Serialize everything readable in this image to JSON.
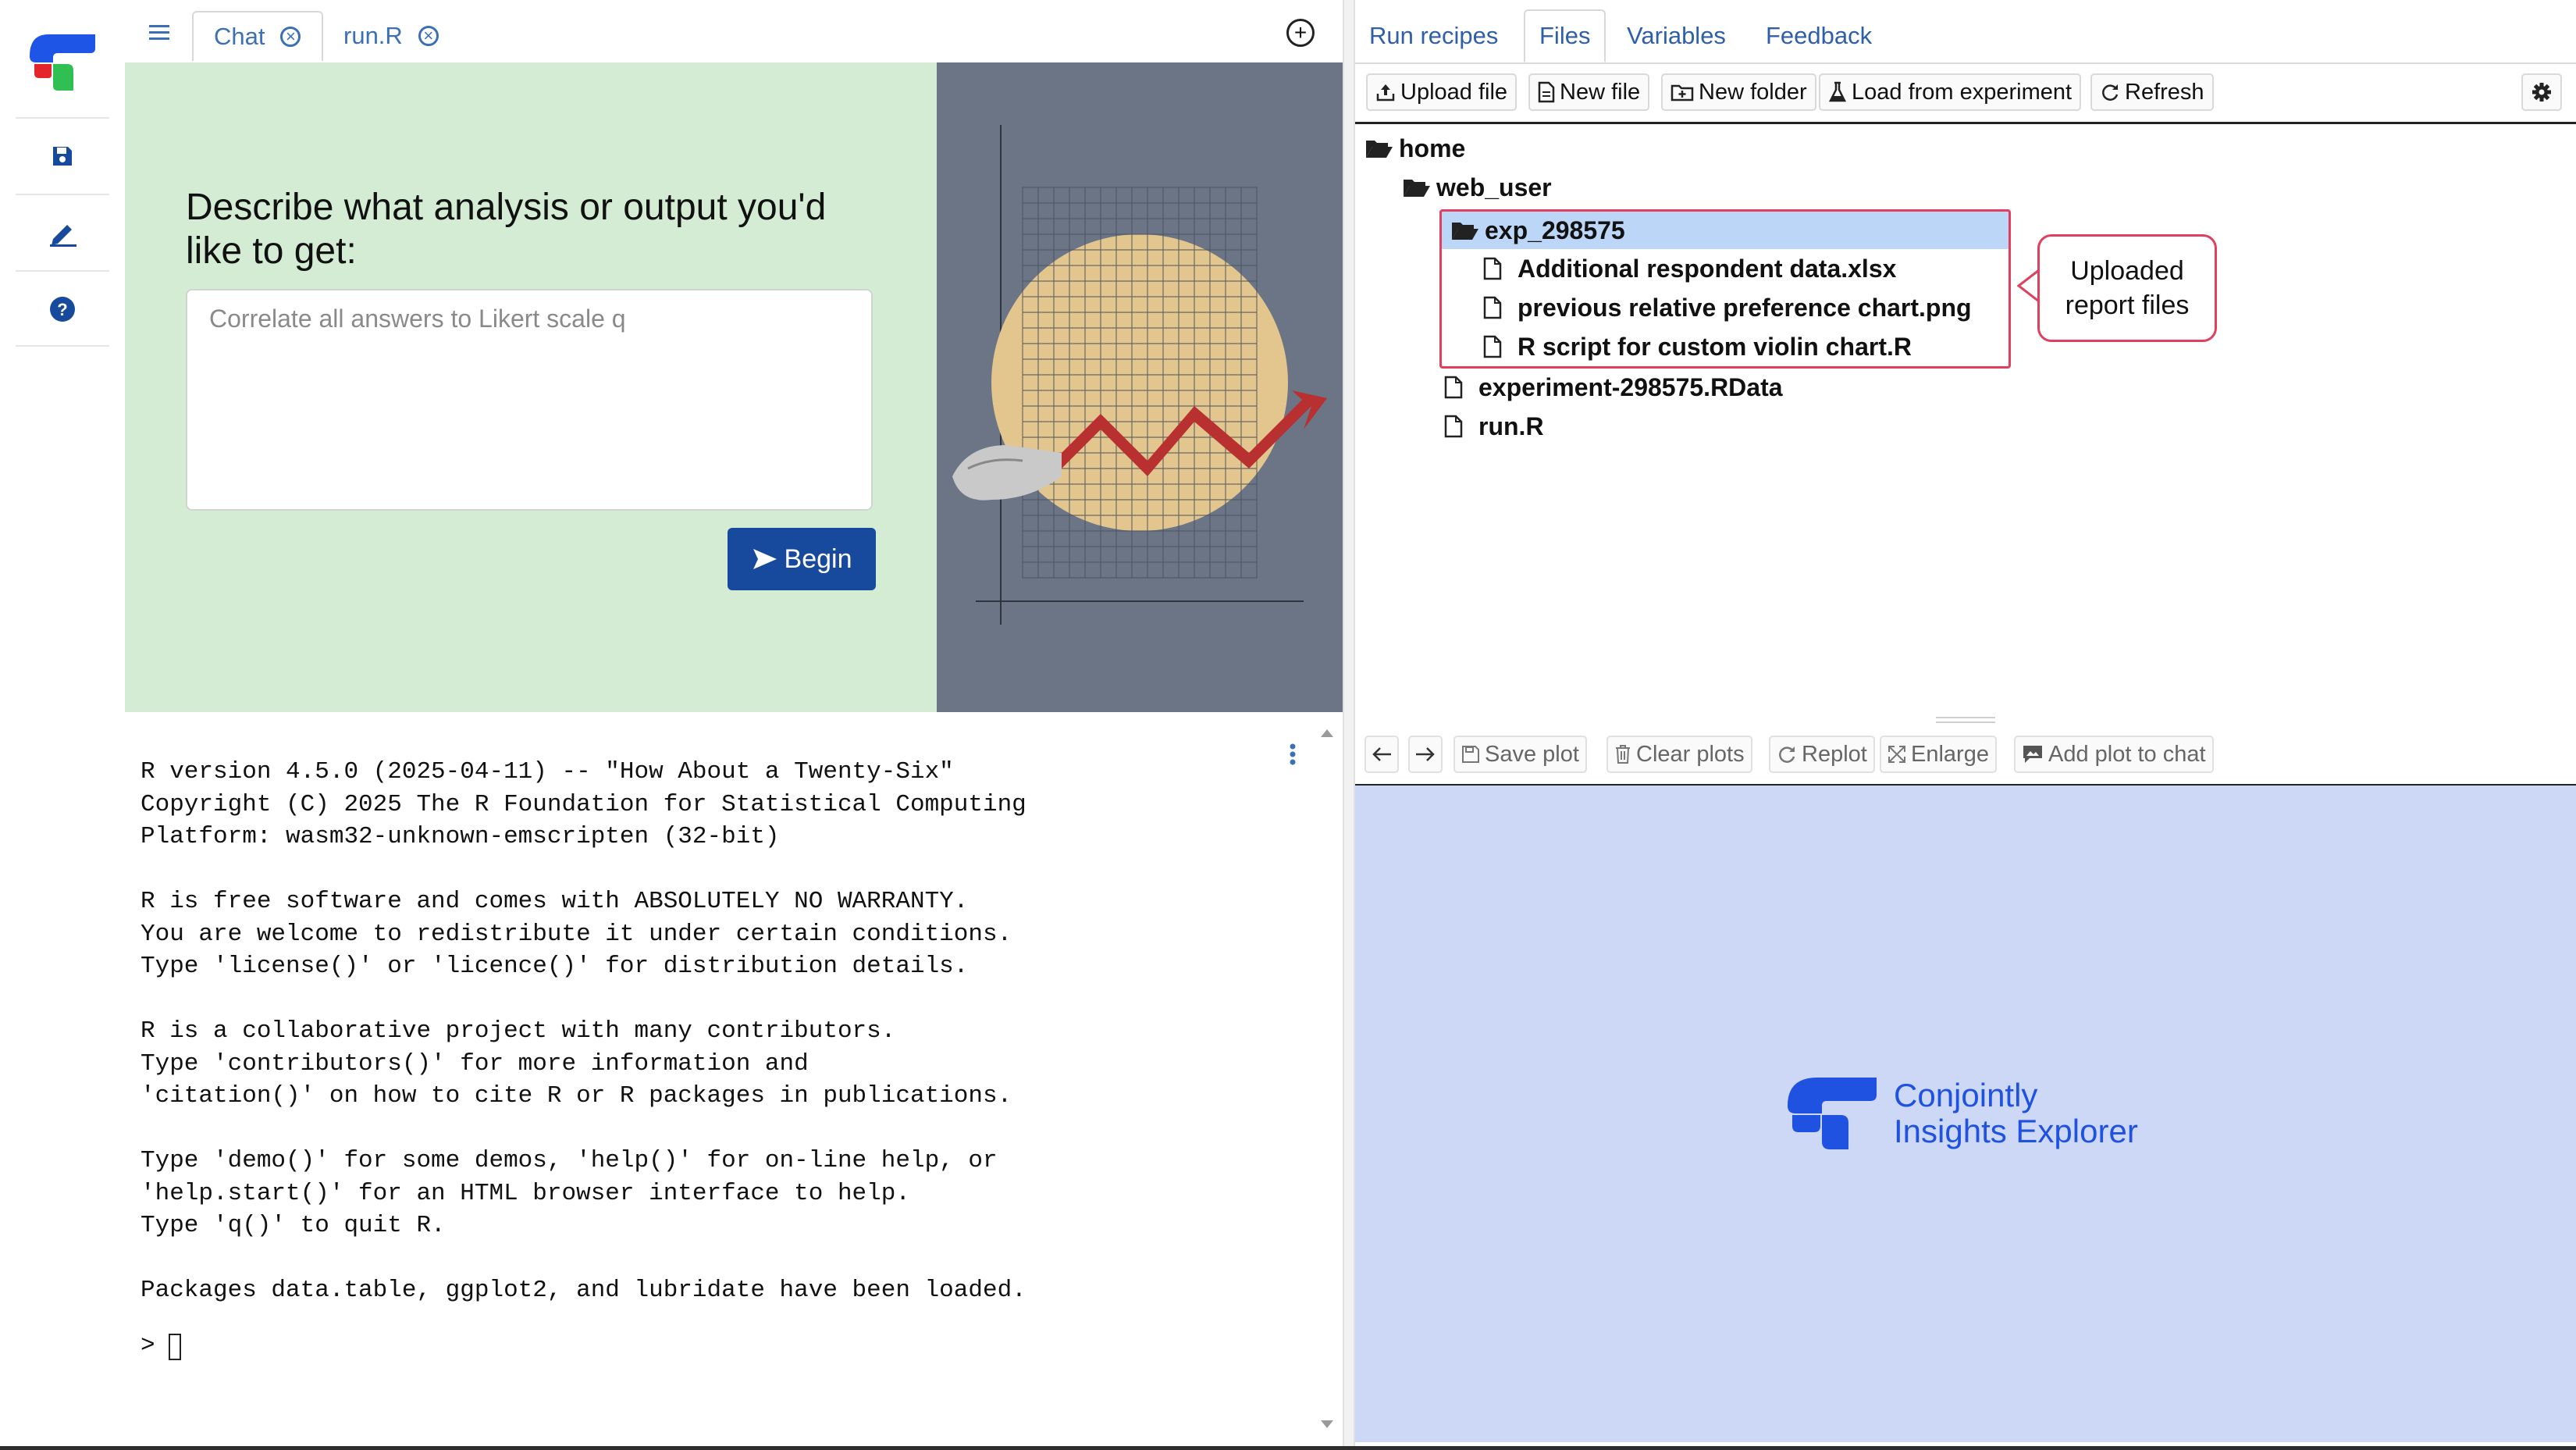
{
  "left_tabs": [
    {
      "label": "Chat",
      "active": true
    },
    {
      "label": "run.R",
      "active": false
    }
  ],
  "hero": {
    "prompt": "Describe what analysis or output you'd like to get:",
    "input_placeholder": "Correlate all answers to Likert scale q",
    "begin_label": "Begin"
  },
  "console_text": "R version 4.5.0 (2025-04-11) -- \"How About a Twenty-Six\"\nCopyright (C) 2025 The R Foundation for Statistical Computing\nPlatform: wasm32-unknown-emscripten (32-bit)\n\nR is free software and comes with ABSOLUTELY NO WARRANTY.\nYou are welcome to redistribute it under certain conditions.\nType 'license()' or 'licence()' for distribution details.\n\nR is a collaborative project with many contributors.\nType 'contributors()' for more information and\n'citation()' on how to cite R or R packages in publications.\n\nType 'demo()' for some demos, 'help()' for on-line help, or\n'help.start()' for an HTML browser interface to help.\nType 'q()' to quit R.\n\nPackages data.table, ggplot2, and lubridate have been loaded.",
  "console_prompt": ">",
  "right_tabs": [
    {
      "label": "Run recipes",
      "active": false
    },
    {
      "label": "Files",
      "active": true
    },
    {
      "label": "Variables",
      "active": false
    },
    {
      "label": "Feedback",
      "active": false
    }
  ],
  "file_toolbar": {
    "upload": "Upload file",
    "new_file": "New file",
    "new_folder": "New folder",
    "load_experiment": "Load from experiment",
    "refresh": "Refresh"
  },
  "tree": {
    "home": "home",
    "web_user": "web_user",
    "exp_folder": "exp_298575",
    "file1": "Additional respondent data.xlsx",
    "file2": "previous relative preference chart.png",
    "file3": "R script for custom violin chart.R",
    "file4": "experiment-298575.RData",
    "file5": "run.R"
  },
  "callout": "Uploaded report files",
  "plot_toolbar": {
    "save": "Save plot",
    "clear": "Clear plots",
    "replot": "Replot",
    "enlarge": "Enlarge",
    "add_to_chat": "Add plot to chat"
  },
  "brand": {
    "line1": "Conjointly",
    "line2": "Insights Explorer"
  },
  "colors": {
    "accent_blue": "#1f52e0",
    "hero_green": "#d4ecd4",
    "plot_bg": "#cdd8f7",
    "highlight_border": "#e0405e",
    "selected_row": "#bcd6f7",
    "begin_button": "#174a9c"
  }
}
